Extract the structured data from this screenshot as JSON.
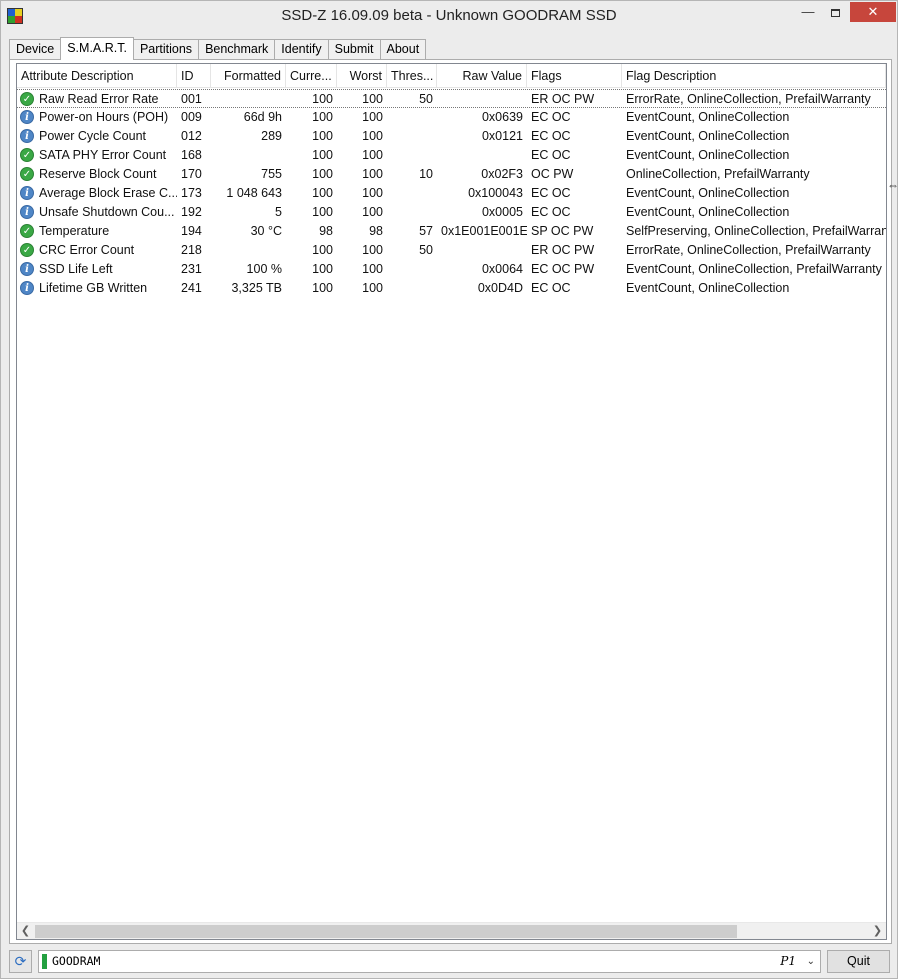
{
  "window": {
    "title": "SSD-Z 16.09.09 beta - Unknown GOODRAM SSD",
    "minimize": "—",
    "close": "✕"
  },
  "tabs": [
    {
      "label": "Device",
      "active": false
    },
    {
      "label": "S.M.A.R.T.",
      "active": true
    },
    {
      "label": "Partitions",
      "active": false
    },
    {
      "label": "Benchmark",
      "active": false
    },
    {
      "label": "Identify",
      "active": false
    },
    {
      "label": "Submit",
      "active": false
    },
    {
      "label": "About",
      "active": false
    }
  ],
  "columns": [
    "Attribute Description",
    "ID",
    "Formatted",
    "Curre...",
    "Worst",
    "Thres...",
    "Raw Value",
    "Flags",
    "Flag Description"
  ],
  "rows": [
    {
      "status": "ok",
      "desc": "Raw Read Error Rate",
      "id": "001",
      "formatted": "",
      "current": "100",
      "worst": "100",
      "threshold": "50",
      "raw": "",
      "flags": "ER OC PW",
      "flagdesc": "ErrorRate, OnlineCollection, PrefailWarranty"
    },
    {
      "status": "info",
      "desc": "Power-on Hours (POH)",
      "id": "009",
      "formatted": "66d 9h",
      "current": "100",
      "worst": "100",
      "threshold": "",
      "raw": "0x0639",
      "flags": "EC OC",
      "flagdesc": "EventCount, OnlineCollection"
    },
    {
      "status": "info",
      "desc": "Power Cycle Count",
      "id": "012",
      "formatted": "289",
      "current": "100",
      "worst": "100",
      "threshold": "",
      "raw": "0x0121",
      "flags": "EC OC",
      "flagdesc": "EventCount, OnlineCollection"
    },
    {
      "status": "ok",
      "desc": "SATA PHY Error Count",
      "id": "168",
      "formatted": "",
      "current": "100",
      "worst": "100",
      "threshold": "",
      "raw": "",
      "flags": "EC OC",
      "flagdesc": "EventCount, OnlineCollection"
    },
    {
      "status": "ok",
      "desc": "Reserve Block Count",
      "id": "170",
      "formatted": "755",
      "current": "100",
      "worst": "100",
      "threshold": "10",
      "raw": "0x02F3",
      "flags": "OC PW",
      "flagdesc": "OnlineCollection, PrefailWarranty"
    },
    {
      "status": "info",
      "desc": "Average Block Erase C...",
      "id": "173",
      "formatted": "1 048 643",
      "current": "100",
      "worst": "100",
      "threshold": "",
      "raw": "0x100043",
      "flags": "EC OC",
      "flagdesc": "EventCount, OnlineCollection"
    },
    {
      "status": "info",
      "desc": "Unsafe Shutdown Cou...",
      "id": "192",
      "formatted": "5",
      "current": "100",
      "worst": "100",
      "threshold": "",
      "raw": "0x0005",
      "flags": "EC OC",
      "flagdesc": "EventCount, OnlineCollection"
    },
    {
      "status": "ok",
      "desc": "Temperature",
      "id": "194",
      "formatted": "30 °C",
      "current": "98",
      "worst": "98",
      "threshold": "57",
      "raw": "0x1E001E001E",
      "flags": "SP OC PW",
      "flagdesc": "SelfPreserving, OnlineCollection, PrefailWarranty"
    },
    {
      "status": "ok",
      "desc": "CRC Error Count",
      "id": "218",
      "formatted": "",
      "current": "100",
      "worst": "100",
      "threshold": "50",
      "raw": "",
      "flags": "ER OC PW",
      "flagdesc": "ErrorRate, OnlineCollection, PrefailWarranty"
    },
    {
      "status": "info",
      "desc": "SSD Life Left",
      "id": "231",
      "formatted": "100 %",
      "current": "100",
      "worst": "100",
      "threshold": "",
      "raw": "0x0064",
      "flags": "EC OC PW",
      "flagdesc": "EventCount, OnlineCollection, PrefailWarranty"
    },
    {
      "status": "info",
      "desc": "Lifetime GB Written",
      "id": "241",
      "formatted": "3,325 TB",
      "current": "100",
      "worst": "100",
      "threshold": "",
      "raw": "0x0D4D",
      "flags": "EC OC",
      "flagdesc": "EventCount, OnlineCollection"
    }
  ],
  "bottom": {
    "drive_name": "GOODRAM",
    "partition": "P1",
    "quit_label": "Quit"
  },
  "colors": {
    "ok_icon": "#3aa845",
    "info_icon": "#4f86c6",
    "drive_bar": "#23a040",
    "close_button": "#c7463c"
  }
}
